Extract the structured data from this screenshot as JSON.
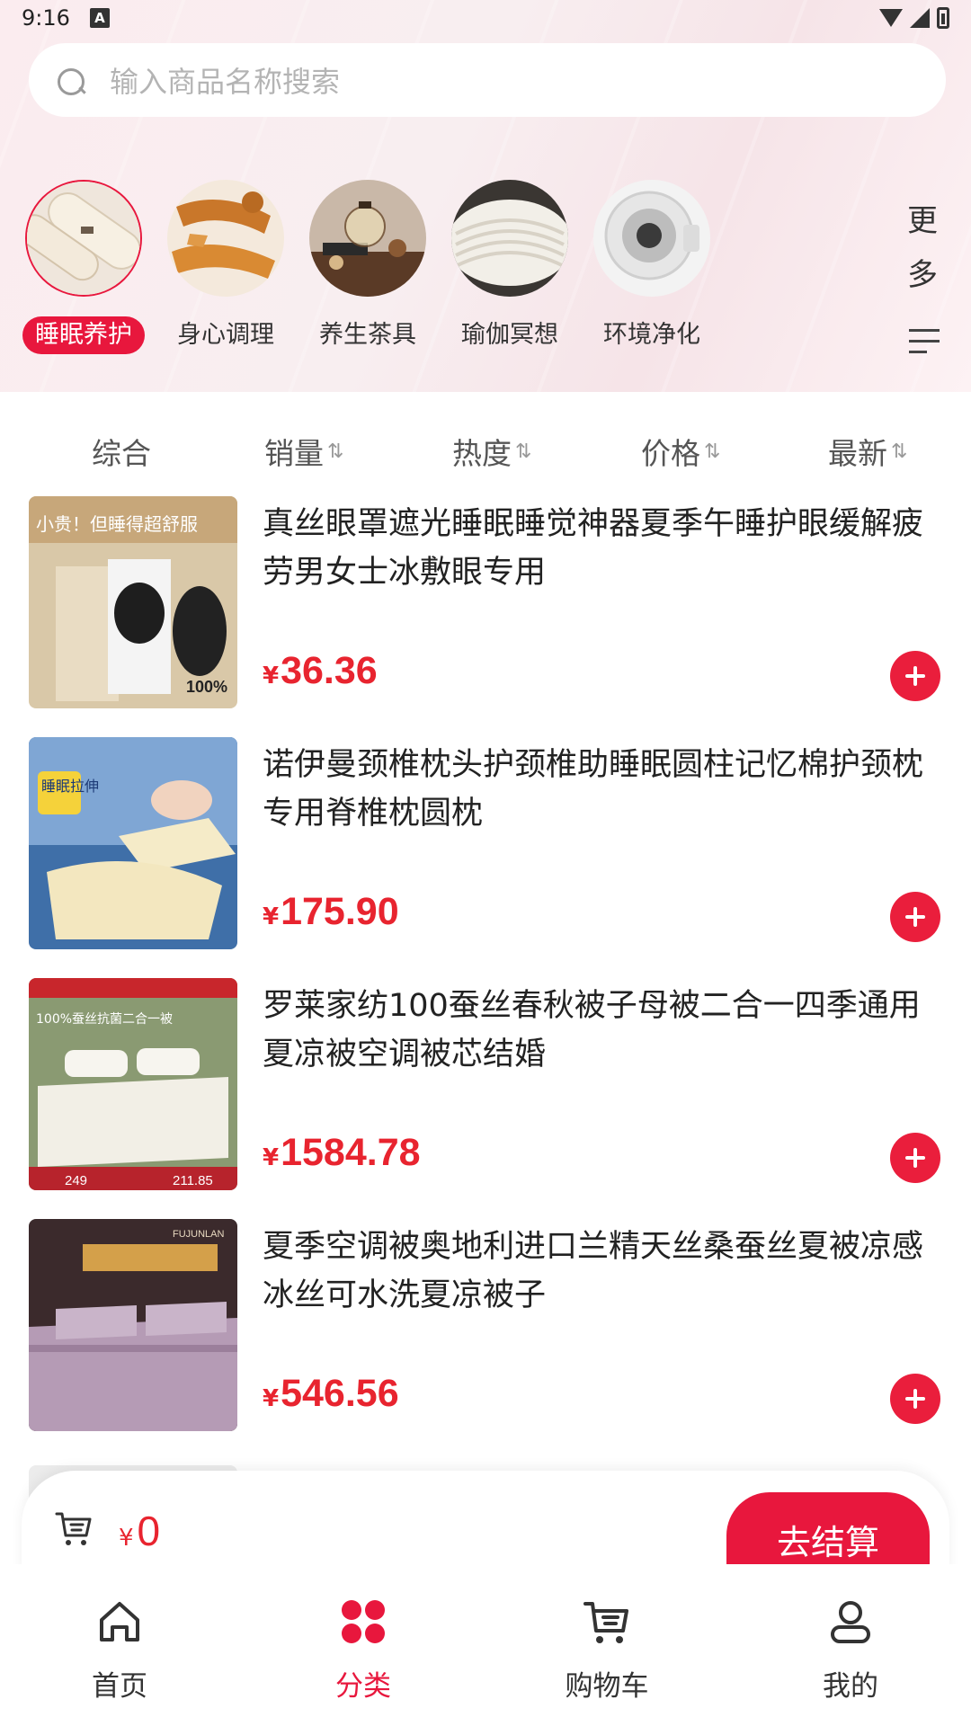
{
  "status_bar": {
    "time": "9:16",
    "notification_icon": "A"
  },
  "search": {
    "placeholder": "输入商品名称搜索"
  },
  "categories": [
    {
      "label": "睡眠养护",
      "active": true
    },
    {
      "label": "身心调理",
      "active": false
    },
    {
      "label": "养生茶具",
      "active": false
    },
    {
      "label": "瑜伽冥想",
      "active": false
    },
    {
      "label": "环境净化",
      "active": false
    }
  ],
  "more": {
    "label": "更多"
  },
  "sort": {
    "items": [
      {
        "label": "综合"
      },
      {
        "label": "销量"
      },
      {
        "label": "热度"
      },
      {
        "label": "价格"
      },
      {
        "label": "最新"
      }
    ],
    "arrow_glyph": "⇅"
  },
  "products": [
    {
      "title": "真丝眼罩遮光睡眠睡觉神器夏季午睡护眼缓解疲劳男女士冰敷眼专用",
      "currency": "¥",
      "price": "36.36",
      "image_text": "小贵！但睡得超舒服",
      "image_badge": "100%"
    },
    {
      "title": "诺伊曼颈椎枕头护颈椎助睡眠圆柱记忆棉护颈枕专用脊椎枕圆枕",
      "currency": "¥",
      "price": "175.90",
      "image_text": "睡眠拉伸"
    },
    {
      "title": "罗莱家纺100蚕丝春秋被子母被二合一四季通用夏凉被空调被芯结婚",
      "currency": "¥",
      "price": "1584.78",
      "image_text": "100%蚕丝抗菌二合一被",
      "image_price_a": "249",
      "image_price_b": "211.85"
    },
    {
      "title": "夏季空调被奥地利进口兰精天丝桑蚕丝夏被凉感冰丝可水洗夏凉被子",
      "currency": "¥",
      "price": "546.56",
      "image_text": "FUJUNLAN"
    }
  ],
  "cart": {
    "currency": "¥",
    "amount": "0",
    "checkout_label": "去结算"
  },
  "tabbar": {
    "items": [
      {
        "label": "首页",
        "active": false
      },
      {
        "label": "分类",
        "active": true
      },
      {
        "label": "购物车",
        "active": false
      },
      {
        "label": "我的",
        "active": false
      }
    ]
  },
  "colors": {
    "accent": "#e8173d",
    "price": "#e8242f"
  }
}
